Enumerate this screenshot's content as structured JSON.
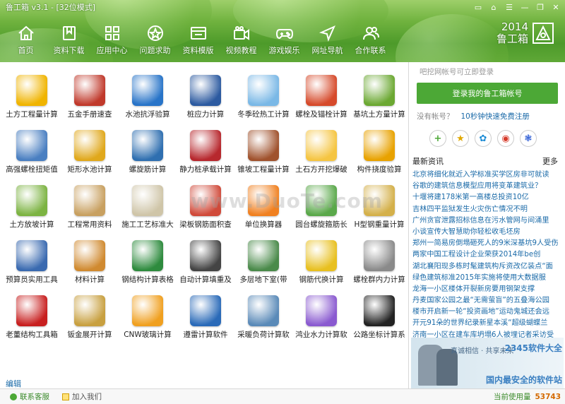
{
  "window": {
    "title": "鲁工箱 v3.1 - [32位模式]",
    "controls": [
      "minimize",
      "skin",
      "shirt",
      "menu",
      "restore",
      "close"
    ]
  },
  "nav": [
    {
      "label": "首页",
      "icon": "home-icon"
    },
    {
      "label": "资料下载",
      "icon": "bookmark-icon"
    },
    {
      "label": "应用中心",
      "icon": "grid-icon"
    },
    {
      "label": "问题求助",
      "icon": "help-icon"
    },
    {
      "label": "资料模版",
      "icon": "template-icon"
    },
    {
      "label": "视频教程",
      "icon": "video-icon"
    },
    {
      "label": "游戏娱乐",
      "icon": "gamepad-icon"
    },
    {
      "label": "网址导航",
      "icon": "navigation-icon"
    },
    {
      "label": "合作联系",
      "icon": "contact-icon"
    }
  ],
  "brand": {
    "year": "2014",
    "name": "鲁工箱"
  },
  "tools": [
    {
      "label": "土方工程量计算",
      "icon": "bulldozer-icon",
      "color": "#f0b400"
    },
    {
      "label": "五金手册速查",
      "icon": "tools-icon",
      "color": "#c0392b"
    },
    {
      "label": "水池抗浮验算",
      "icon": "pool-icon",
      "color": "#2874c8"
    },
    {
      "label": "桩应力计算",
      "icon": "pencil-icon",
      "color": "#2c5aa0"
    },
    {
      "label": "冬季砼热工计算",
      "icon": "snowflake-icon",
      "color": "#7ab8e6"
    },
    {
      "label": "螺栓及锚栓计算",
      "icon": "firewall-icon",
      "color": "#d64a2b"
    },
    {
      "label": "基坑土方量计算",
      "icon": "globe-icon",
      "color": "#6ba832"
    },
    {
      "label": "高强螺栓扭矩值",
      "icon": "wrench-icon",
      "color": "#4a7fc1"
    },
    {
      "label": "矩形水池计算",
      "icon": "sphere-icon",
      "color": "#e0a81c"
    },
    {
      "label": "螺旋筋计算",
      "icon": "spiral-icon",
      "color": "#2f6fb0"
    },
    {
      "label": "静力桩承载计算",
      "icon": "anchor-icon",
      "color": "#b7282e"
    },
    {
      "label": "锥坡工程量计算",
      "icon": "building-icon",
      "color": "#a0522d"
    },
    {
      "label": "土石方开挖爆破",
      "icon": "explosion-icon",
      "color": "#f5c542"
    },
    {
      "label": "构件挠度验算",
      "icon": "excavator-icon",
      "color": "#e8a200"
    },
    {
      "label": "土方放坡计算",
      "icon": "landscape-icon",
      "color": "#7cb342"
    },
    {
      "label": "工程常用资料",
      "icon": "folder-icon",
      "color": "#c8a060"
    },
    {
      "label": "施工工艺标准大",
      "icon": "document-icon",
      "color": "#cfc5a8"
    },
    {
      "label": "梁板钢筋面积查",
      "icon": "table-icon",
      "color": "#d04a3a"
    },
    {
      "label": "单位换算器",
      "icon": "calculator-icon",
      "color": "#f08020"
    },
    {
      "label": "圆台螺旋箍筋长",
      "icon": "cone-icon",
      "color": "#5aa84a"
    },
    {
      "label": "H型钢重量计算",
      "icon": "airplane-icon",
      "color": "#d4b04a"
    },
    {
      "label": "预算员实用工具",
      "icon": "screwdriver-icon",
      "color": "#3a6ab0"
    },
    {
      "label": "材料计算",
      "icon": "megaphone-icon",
      "color": "#d08a30"
    },
    {
      "label": "钢结构计算表格",
      "icon": "excel-icon",
      "color": "#2e8b3e"
    },
    {
      "label": "自动计算填重及",
      "icon": "stairs-icon",
      "color": "#444444"
    },
    {
      "label": "多层地下室(带",
      "icon": "garage-icon",
      "color": "#4a8a4a"
    },
    {
      "label": "钢筋代换计算",
      "icon": "ruler-icon",
      "color": "#e8c020"
    },
    {
      "label": "螺栓群内力计算",
      "icon": "bolt-icon",
      "color": "#8a8a8a"
    },
    {
      "label": "老董结构工具箱",
      "icon": "toolbox-icon",
      "color": "#c82020"
    },
    {
      "label": "钣金展开计算",
      "icon": "metal-sheet-icon",
      "color": "#c8a040"
    },
    {
      "label": "CNW玻璃计算",
      "icon": "fishbowl-icon",
      "color": "#f0a020"
    },
    {
      "label": "遵雷计算软件",
      "icon": "refresh-icon",
      "color": "#2a6ab8"
    },
    {
      "label": "采暖负荷计算软",
      "icon": "images-icon",
      "color": "#5a8ab8"
    },
    {
      "label": "鸿业水力计算软",
      "icon": "bubble-icon",
      "color": "#8a5ad0"
    },
    {
      "label": "公路坐标计算系",
      "icon": "road-icon",
      "color": "#222222"
    }
  ],
  "edit_link": "编辑",
  "side": {
    "hint": "吧挖网帐号可立即登录",
    "login_button": "登录我的鲁工箱帐号",
    "register_prompt": "没有帐号？",
    "register_link": "10秒钟快速免费注册",
    "socials": [
      {
        "icon": "plus-icon",
        "color": "#4ca836"
      },
      {
        "icon": "star-icon",
        "color": "#e0a800"
      },
      {
        "icon": "qzone-icon",
        "color": "#1a8ad4"
      },
      {
        "icon": "weibo-icon",
        "color": "#d63a2a"
      },
      {
        "icon": "paw-icon",
        "color": "#2a5ad4"
      }
    ],
    "news_title": "最新资讯",
    "news_more": "更多",
    "news": [
      "北京将细化就近入学标准买学区房非可就读",
      "谷歌的建筑信息模型应用将变革建筑业？",
      "十堰将建178米第一高楼总投资10亿",
      "吉林四平监狱发生火灾伤亡情况不明",
      "广州贪官泄露招标信息在污水管网与间涌里",
      "小谈宣传大智慧助你轻松收毛坯房",
      "郑州一简易房倒塌砸死人的9米深基坑9人受伤",
      "两家中国工程设计企业荣获2014年be创",
      "湖北襄阳现多栋时髦建筑构斥资改亿装点“面",
      "绿色建筑标准2015年实施将使用大数据服",
      "龙海一小区楼体开裂新房要用钢架支撑",
      "丹麦国家公园之最“无需萤盲”的五叠海公园",
      "楼市开启新一轮“投资画地”运动鬼城还会远",
      "开元91朵的世界纪录新星本溪“超级蝴蝶兰",
      "济南一小区在建车库坍塌6人被埋记者采访受"
    ],
    "ad": {
      "slogan": "真诚相信 · 共享未来",
      "watermark_top": "2345软件大全",
      "watermark_bottom": "国内最安全的软件站"
    }
  },
  "status": {
    "support": "联系客服",
    "join": "加入我们",
    "usage_label": "当前使用量",
    "usage_value": "53743"
  },
  "watermark": "www.DuoTe.com"
}
